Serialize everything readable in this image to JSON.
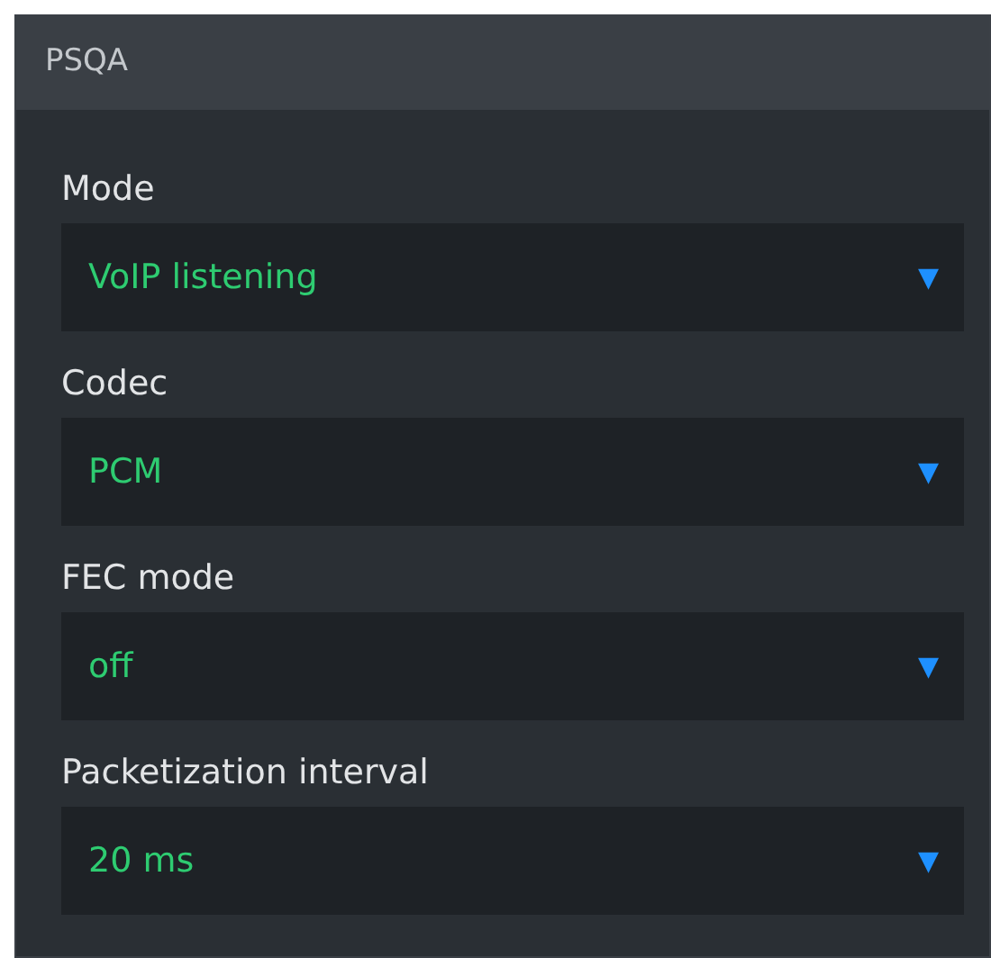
{
  "panel": {
    "title": "PSQA"
  },
  "fields": [
    {
      "label": "Mode",
      "value": "VoIP listening",
      "arrow": "▼"
    },
    {
      "label": "Codec",
      "value": "PCM",
      "arrow": "▼"
    },
    {
      "label": "FEC mode",
      "value": "off",
      "arrow": "▼"
    },
    {
      "label": "Packetization interval",
      "value": "20 ms",
      "arrow": "▼"
    }
  ]
}
